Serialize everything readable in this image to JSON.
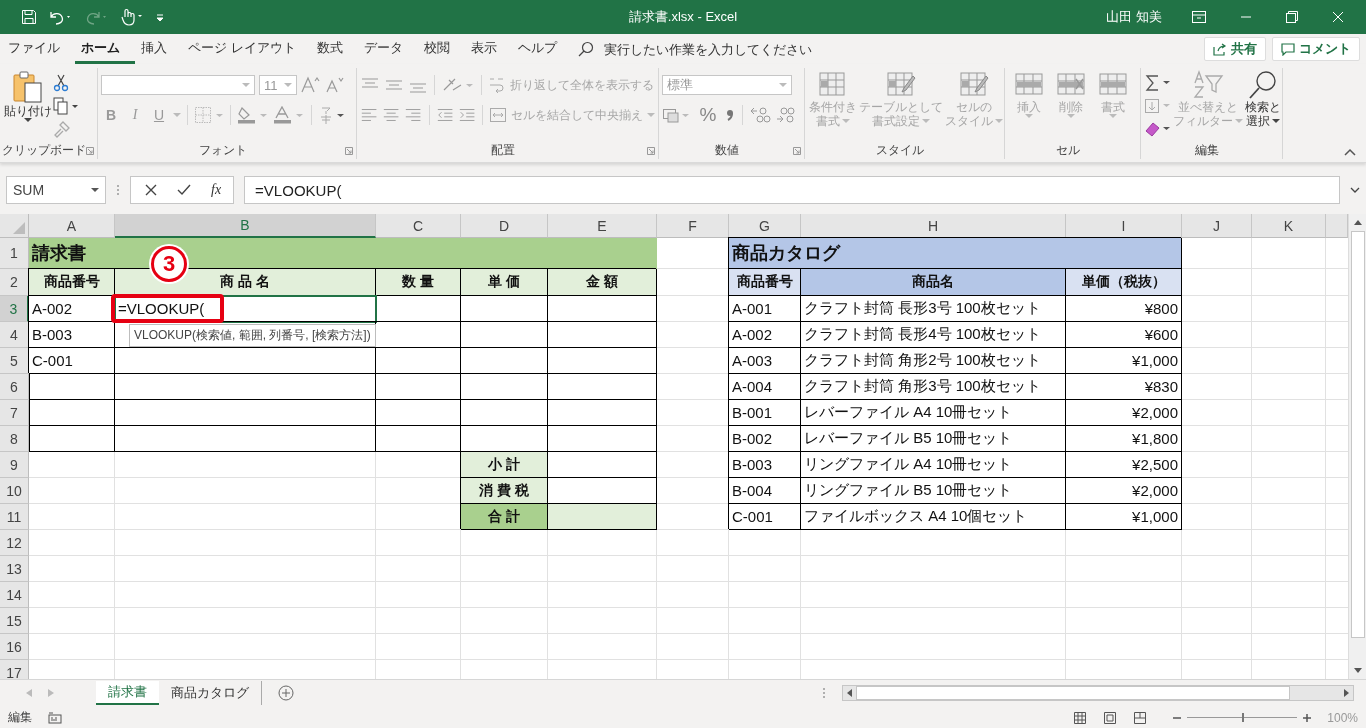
{
  "title_bar": {
    "title": "請求書.xlsx  -  Excel",
    "user": "山田 知美"
  },
  "menu_tabs": [
    {
      "label": "ファイル",
      "selected": false
    },
    {
      "label": "ホーム",
      "selected": true
    },
    {
      "label": "挿入",
      "selected": false
    },
    {
      "label": "ページ レイアウト",
      "selected": false
    },
    {
      "label": "数式",
      "selected": false
    },
    {
      "label": "データ",
      "selected": false
    },
    {
      "label": "校閲",
      "selected": false
    },
    {
      "label": "表示",
      "selected": false
    },
    {
      "label": "ヘルプ",
      "selected": false
    }
  ],
  "tell_me": {
    "placeholder": "実行したい作業を入力してください"
  },
  "share_button": "共有",
  "comment_button": "コメント",
  "ribbon": {
    "clipboard": {
      "label": "クリップボード",
      "paste": {
        "label": "貼り付け",
        "disabled": false
      }
    },
    "font": {
      "label": "フォント",
      "font_size": "11",
      "bold": "B",
      "italic": "I",
      "underline": "U",
      "disabled": true
    },
    "alignment": {
      "label": "配置",
      "wrap": {
        "label": "折り返して全体を表示する",
        "disabled": true
      },
      "merge": {
        "label": "セルを結合して中央揃え",
        "disabled": true
      }
    },
    "number": {
      "label": "数値",
      "format": "標準",
      "percent": "%",
      "disabled": true
    },
    "styles": {
      "label": "スタイル",
      "buttons": [
        {
          "lines": [
            "条件付き",
            "書式"
          ],
          "disabled": true
        },
        {
          "lines": [
            "テーブルとして",
            "書式設定"
          ],
          "disabled": true
        },
        {
          "lines": [
            "セルの",
            "スタイル"
          ],
          "disabled": true
        }
      ]
    },
    "cells": {
      "label": "セル",
      "buttons": [
        {
          "lines": [
            "挿入"
          ],
          "disabled": true
        },
        {
          "lines": [
            "削除"
          ],
          "disabled": true
        },
        {
          "lines": [
            "書式"
          ],
          "disabled": true
        }
      ]
    },
    "editing": {
      "label": "編集",
      "buttons": [
        {
          "lines": [
            "並べ替えと",
            "フィルター"
          ],
          "disabled": true
        },
        {
          "lines": [
            "検索と",
            "選択"
          ],
          "disabled": false
        }
      ]
    }
  },
  "formula_bar": {
    "name_box": "SUM",
    "fx": "fx",
    "formula": "=VLOOKUP("
  },
  "sheet": {
    "columns": [
      {
        "label": "A",
        "selected": false
      },
      {
        "label": "B",
        "selected": true
      },
      {
        "label": "C",
        "selected": false
      },
      {
        "label": "D",
        "selected": false
      },
      {
        "label": "E",
        "selected": false
      },
      {
        "label": "F",
        "selected": false
      },
      {
        "label": "G",
        "selected": false
      },
      {
        "label": "H",
        "selected": false
      },
      {
        "label": "I",
        "selected": false
      },
      {
        "label": "J",
        "selected": false
      },
      {
        "label": "K",
        "selected": false
      }
    ],
    "rows": [
      {
        "number": "1",
        "selected": false,
        "cells": [
          {
            "kind": "title-green",
            "text": "請求書"
          },
          {
            "kind": "merged"
          },
          {
            "kind": "merged"
          },
          {
            "kind": "merged"
          },
          {
            "kind": "merged"
          },
          {
            "kind": "blank"
          },
          {
            "kind": "title-blue",
            "text": "商品カタログ"
          },
          {
            "kind": "merged"
          },
          {
            "kind": "merged"
          }
        ]
      },
      {
        "number": "2",
        "selected": false,
        "cells": [
          {
            "kind": "head-green",
            "text": "商品番号"
          },
          {
            "kind": "head-green",
            "text": "商 品 名"
          },
          {
            "kind": "head-green",
            "text": "数 量"
          },
          {
            "kind": "head-green",
            "text": "単 価"
          },
          {
            "kind": "head-green",
            "text": "金 額"
          },
          {
            "kind": "blank"
          },
          {
            "kind": "head-blue",
            "text": "商品番号"
          },
          {
            "kind": "head-blue-dark",
            "text": "商品名"
          },
          {
            "kind": "head-blue",
            "text": "単価（税抜）"
          }
        ]
      },
      {
        "number": "3",
        "selected": true,
        "cells": [
          {
            "kind": "cell",
            "text": "A-002"
          },
          {
            "kind": "cell",
            "text": "=VLOOKUP("
          },
          {
            "kind": "cell"
          },
          {
            "kind": "cell"
          },
          {
            "kind": "cell"
          },
          {
            "kind": "blank"
          },
          {
            "kind": "cell",
            "text": "A-001"
          },
          {
            "kind": "cell",
            "text": "クラフト封筒 長形3号 100枚セット"
          },
          {
            "kind": "number",
            "text": "¥800"
          }
        ]
      },
      {
        "number": "4",
        "selected": false,
        "cells": [
          {
            "kind": "cell",
            "text": "B-003"
          },
          {
            "kind": "cell"
          },
          {
            "kind": "cell"
          },
          {
            "kind": "cell"
          },
          {
            "kind": "cell"
          },
          {
            "kind": "blank"
          },
          {
            "kind": "cell",
            "text": "A-002"
          },
          {
            "kind": "cell",
            "text": "クラフト封筒 長形4号 100枚セット"
          },
          {
            "kind": "number",
            "text": "¥600"
          }
        ]
      },
      {
        "number": "5",
        "selected": false,
        "cells": [
          {
            "kind": "cell",
            "text": "C-001"
          },
          {
            "kind": "cell"
          },
          {
            "kind": "cell"
          },
          {
            "kind": "cell"
          },
          {
            "kind": "cell"
          },
          {
            "kind": "blank"
          },
          {
            "kind": "cell",
            "text": "A-003"
          },
          {
            "kind": "cell",
            "text": "クラフト封筒 角形2号 100枚セット"
          },
          {
            "kind": "number",
            "text": "¥1,000"
          }
        ]
      },
      {
        "number": "6",
        "selected": false,
        "cells": [
          {
            "kind": "cell"
          },
          {
            "kind": "cell"
          },
          {
            "kind": "cell"
          },
          {
            "kind": "cell"
          },
          {
            "kind": "cell"
          },
          {
            "kind": "blank"
          },
          {
            "kind": "cell",
            "text": "A-004"
          },
          {
            "kind": "cell",
            "text": "クラフト封筒 角形3号 100枚セット"
          },
          {
            "kind": "number",
            "text": "¥830"
          }
        ]
      },
      {
        "number": "7",
        "selected": false,
        "cells": [
          {
            "kind": "cell"
          },
          {
            "kind": "cell"
          },
          {
            "kind": "cell"
          },
          {
            "kind": "cell"
          },
          {
            "kind": "cell"
          },
          {
            "kind": "blank"
          },
          {
            "kind": "cell",
            "text": "B-001"
          },
          {
            "kind": "cell",
            "text": "レバーファイル A4 10冊セット"
          },
          {
            "kind": "number",
            "text": "¥2,000"
          }
        ]
      },
      {
        "number": "8",
        "selected": false,
        "cells": [
          {
            "kind": "cell"
          },
          {
            "kind": "cell"
          },
          {
            "kind": "cell"
          },
          {
            "kind": "cell"
          },
          {
            "kind": "cell"
          },
          {
            "kind": "blank"
          },
          {
            "kind": "cell",
            "text": "B-002"
          },
          {
            "kind": "cell",
            "text": "レバーファイル B5 10冊セット"
          },
          {
            "kind": "number",
            "text": "¥1,800"
          }
        ]
      },
      {
        "number": "9",
        "selected": false,
        "cells": [
          {
            "kind": "blank"
          },
          {
            "kind": "blank"
          },
          {
            "kind": "blank"
          },
          {
            "kind": "label-green",
            "text": "小 計"
          },
          {
            "kind": "cell"
          },
          {
            "kind": "blank"
          },
          {
            "kind": "cell",
            "text": "B-003"
          },
          {
            "kind": "cell",
            "text": "リングファイル A4 10冊セット"
          },
          {
            "kind": "number",
            "text": "¥2,500"
          }
        ]
      },
      {
        "number": "10",
        "selected": false,
        "cells": [
          {
            "kind": "blank"
          },
          {
            "kind": "blank"
          },
          {
            "kind": "blank"
          },
          {
            "kind": "label-green",
            "text": "消 費 税"
          },
          {
            "kind": "cell"
          },
          {
            "kind": "blank"
          },
          {
            "kind": "cell",
            "text": "B-004"
          },
          {
            "kind": "cell",
            "text": "リングファイル B5 10冊セット"
          },
          {
            "kind": "number",
            "text": "¥2,000"
          }
        ]
      },
      {
        "number": "11",
        "selected": false,
        "cells": [
          {
            "kind": "blank"
          },
          {
            "kind": "blank"
          },
          {
            "kind": "blank"
          },
          {
            "kind": "label-green-dark",
            "text": "合 計"
          },
          {
            "kind": "value-green"
          },
          {
            "kind": "blank"
          },
          {
            "kind": "cell",
            "text": "C-001"
          },
          {
            "kind": "cell",
            "text": "ファイルボックス A4 10個セット"
          },
          {
            "kind": "number",
            "text": "¥1,000"
          }
        ]
      },
      {
        "number": "12",
        "selected": false
      },
      {
        "number": "13",
        "selected": false
      },
      {
        "number": "14",
        "selected": false
      },
      {
        "number": "15",
        "selected": false
      },
      {
        "number": "16",
        "selected": false
      },
      {
        "number": "17",
        "selected": false
      }
    ],
    "tooltip": "VLOOKUP(検索値, 範囲, 列番号, [検索方法])",
    "step_badge": "3"
  },
  "sheet_tabs": [
    {
      "label": "請求書",
      "selected": true
    },
    {
      "label": "商品カタログ",
      "selected": false
    }
  ],
  "status_bar": {
    "mode": "編集",
    "zoom_slider": {
      "level": 0.5
    },
    "zoom": "100%"
  }
}
